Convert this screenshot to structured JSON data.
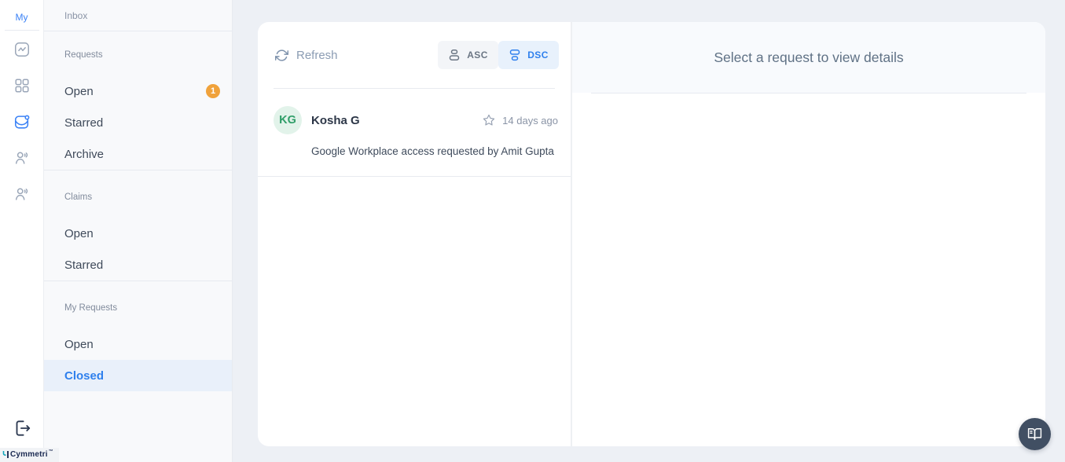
{
  "rail": {
    "top_label": "My"
  },
  "sidebar": {
    "header": "Inbox",
    "sections": [
      {
        "label": "Requests",
        "items": [
          {
            "label": "Open",
            "badge": "1"
          },
          {
            "label": "Starred"
          },
          {
            "label": "Archive"
          }
        ]
      },
      {
        "label": "Claims",
        "items": [
          {
            "label": "Open"
          },
          {
            "label": "Starred"
          }
        ]
      },
      {
        "label": "My Requests",
        "items": [
          {
            "label": "Open"
          },
          {
            "label": "Closed"
          }
        ]
      }
    ]
  },
  "list_panel": {
    "refresh_label": "Refresh",
    "sort_asc_label": "ASC",
    "sort_dsc_label": "DSC",
    "active_sort": "DSC",
    "items": [
      {
        "initials": "KG",
        "name": "Kosha G",
        "time": "14 days ago",
        "message": "Google Workplace access requested by Amit Gupta"
      }
    ]
  },
  "detail_panel": {
    "empty_state": "Select a request to view details"
  },
  "footer": {
    "brand": "Cymmetri",
    "trademark": "™"
  },
  "colors": {
    "accent": "#3b82f6",
    "badge_orange": "#f0a23b",
    "avatar_bg": "#e2f3ea",
    "avatar_text": "#2f9e68",
    "active_item_bg": "#e9f0fa",
    "fab_bg": "#414f63",
    "page_bg": "#edf0f5",
    "sidebar_bg": "#f8f9fb"
  }
}
